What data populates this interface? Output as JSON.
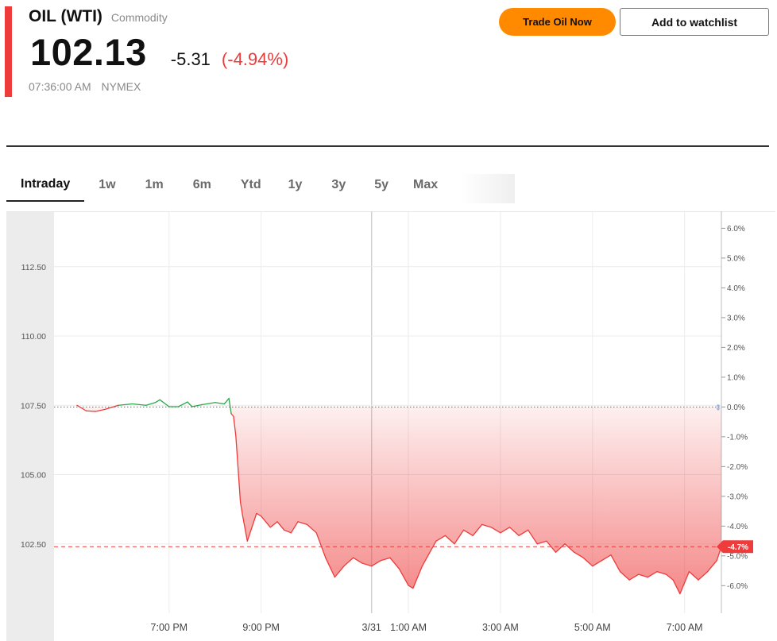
{
  "quote": {
    "name": "OIL (WTI)",
    "kind": "Commodity",
    "price": "102.13",
    "change": "-5.31",
    "change_pct": "(-4.94%)",
    "time": "07:36:00 AM",
    "exchange": "NYMEX"
  },
  "actions": {
    "trade_label": "Trade Oil Now",
    "watchlist_label": "Add to watchlist"
  },
  "tabs": [
    "Intraday",
    "1w",
    "1m",
    "6m",
    "Ytd",
    "1y",
    "3y",
    "5y",
    "Max"
  ],
  "active_tab": "Intraday",
  "colors": {
    "accent_red": "#ee3b3b",
    "accent_green": "#2aa84a",
    "trade_orange": "#ff8a00"
  },
  "chart_data": {
    "type": "area",
    "title": "",
    "xlabel": "",
    "ylabel": "",
    "x_tick_labels": [
      "7:00 PM",
      "9:00 PM",
      "3/31",
      "1:00 AM",
      "3:00 AM",
      "5:00 AM",
      "7:00 AM"
    ],
    "x_ticks_hours": [
      0,
      2,
      4.4,
      5.2,
      7.2,
      9.2,
      11.2
    ],
    "y_ticks": [
      102.5,
      105.0,
      107.5,
      110.0,
      112.5
    ],
    "y_tick_labels": [
      "102.50",
      "105.00",
      "107.50",
      "110.00",
      "112.50"
    ],
    "y_right_ticks": [
      6,
      5,
      4,
      3,
      2,
      1,
      0,
      -1,
      -2,
      -3,
      -4,
      -5,
      -6
    ],
    "y_right_tick_labels": [
      "6.0%",
      "5.0%",
      "4.0%",
      "3.0%",
      "2.0%",
      "1.0%",
      "0.0%",
      "-1.0%",
      "-2.0%",
      "-3.0%",
      "-4.0%",
      "-5.0%",
      "-6.0%"
    ],
    "ylim": [
      100.0,
      114.5
    ],
    "reference_price": 107.44,
    "current_label": "-4.7%",
    "current_price": 102.4,
    "x_hours": [
      -2.0,
      -1.8,
      -1.6,
      -1.4,
      -1.1,
      -0.8,
      -0.5,
      -0.3,
      -0.2,
      0.0,
      0.2,
      0.4,
      0.5,
      0.7,
      1.0,
      1.2,
      1.3,
      1.35,
      1.4,
      1.45,
      1.5,
      1.55,
      1.6,
      1.7,
      1.8,
      1.9,
      2.0,
      2.1,
      2.2,
      2.35,
      2.5,
      2.65,
      2.8,
      3.0,
      3.2,
      3.4,
      3.6,
      3.8,
      4.0,
      4.2,
      4.4,
      4.6,
      4.8,
      5.0,
      5.2,
      5.3,
      5.4,
      5.5,
      5.6,
      5.8,
      6.0,
      6.2,
      6.4,
      6.6,
      6.8,
      7.0,
      7.2,
      7.4,
      7.6,
      7.8,
      8.0,
      8.2,
      8.4,
      8.6,
      8.8,
      9.0,
      9.2,
      9.4,
      9.6,
      9.8,
      10.0,
      10.2,
      10.4,
      10.6,
      10.8,
      10.95,
      11.1,
      11.3,
      11.5,
      11.7,
      11.9,
      12.0
    ],
    "values": [
      107.5,
      107.3,
      107.28,
      107.35,
      107.5,
      107.55,
      107.5,
      107.6,
      107.7,
      107.45,
      107.45,
      107.62,
      107.45,
      107.52,
      107.6,
      107.55,
      107.75,
      107.2,
      107.1,
      106.4,
      105.2,
      104.0,
      103.5,
      102.6,
      103.1,
      103.6,
      103.5,
      103.3,
      103.1,
      103.3,
      103.0,
      102.9,
      103.3,
      103.2,
      102.9,
      102.0,
      101.3,
      101.7,
      102.0,
      101.8,
      101.7,
      101.9,
      102.0,
      101.6,
      101.0,
      100.9,
      101.3,
      101.7,
      102.0,
      102.6,
      102.8,
      102.5,
      103.0,
      102.8,
      103.2,
      103.1,
      102.9,
      103.1,
      102.8,
      103.0,
      102.5,
      102.6,
      102.2,
      102.5,
      102.2,
      102.0,
      101.7,
      101.9,
      102.1,
      101.5,
      101.2,
      101.4,
      101.3,
      101.5,
      101.4,
      101.2,
      100.7,
      101.5,
      101.2,
      101.5,
      101.9,
      102.4
    ]
  }
}
